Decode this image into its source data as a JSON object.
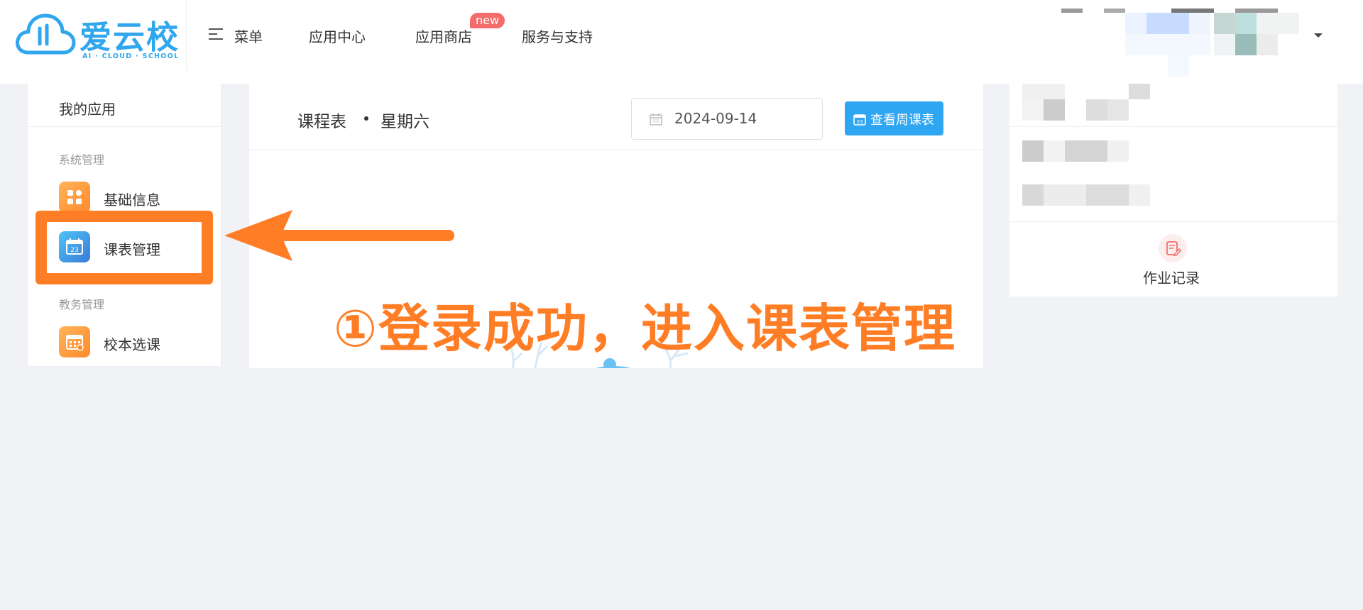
{
  "logo": {
    "text": "爱云校",
    "subtitle": "AI · CLOUD · SCHOOL",
    "color": "#2fa6ee"
  },
  "nav": {
    "menu_label": "菜单",
    "menu_icon": "menu-lines-icon",
    "items": [
      {
        "label": "应用中心"
      },
      {
        "label": "应用商店",
        "badge": "new"
      },
      {
        "label": "服务与支持"
      }
    ]
  },
  "user": {
    "dropdown_icon": "caret-down-icon"
  },
  "sidebar": {
    "title": "我的应用",
    "groups": [
      {
        "label": "系统管理",
        "items": [
          {
            "label": "基础信息",
            "icon": "grid-apps-icon"
          },
          {
            "label": "课表管理",
            "icon": "calendar-icon",
            "highlighted": true
          }
        ]
      },
      {
        "label": "教务管理",
        "items": [
          {
            "label": "校本选课",
            "icon": "calendar-grid-icon"
          }
        ]
      }
    ]
  },
  "schedule": {
    "title": "课程表",
    "weekday": "星期六",
    "date": "2024-09-14",
    "week_button_label": "查看周课表"
  },
  "right_panel": {
    "homework_label": "作业记录",
    "homework_icon": "edit-document-icon"
  },
  "annotation": {
    "text": "①登录成功，进入课表管理",
    "color": "#ff7d25"
  },
  "colors": {
    "background": "#f0f2f5",
    "primary": "#2fa6f2",
    "badge": "#f56c6c",
    "annotation": "#ff7d25"
  }
}
